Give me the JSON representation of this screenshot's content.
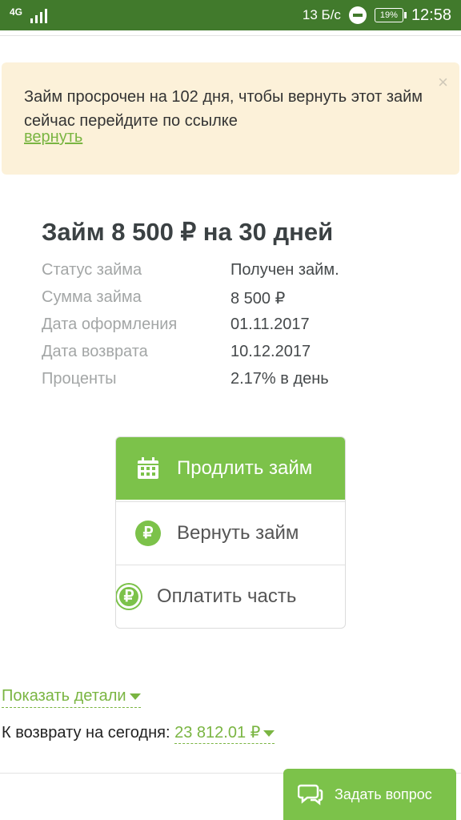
{
  "status_bar": {
    "network": "4G",
    "speed": "13 Б/с",
    "battery": "19%",
    "time": "12:58",
    "icons": [
      "signal-icon",
      "do-not-disturb-icon",
      "battery-icon"
    ]
  },
  "alert": {
    "text": "Займ просрочен на 102 дня, чтобы вернуть этот займ сейчас перейдите по ссылке",
    "link_label": "вернуть",
    "close_label": "×"
  },
  "loan": {
    "title": "Займ 8 500 ₽ на 30 дней",
    "details": [
      {
        "label": "Статус займа",
        "value": "Получен займ."
      },
      {
        "label": "Сумма займа",
        "value": "8 500 ₽"
      },
      {
        "label": "Дата оформления",
        "value": "01.11.2017"
      },
      {
        "label": "Дата возврата",
        "value": "10.12.2017"
      },
      {
        "label": "Проценты",
        "value": "2.17% в день"
      }
    ]
  },
  "actions": {
    "extend": {
      "label": "Продлить займ",
      "icon": "calendar-icon"
    },
    "repay": {
      "label": "Вернуть займ",
      "icon": "ruble-icon",
      "icon_glyph": "₽"
    },
    "pay_part": {
      "label": "Оплатить часть",
      "icon": "ruble-part-icon",
      "icon_glyph": "₽"
    }
  },
  "show_details_label": "Показать детали",
  "repay_today": {
    "label": "К возврату на сегодня:",
    "amount": "23 812.01 ₽"
  },
  "ask_question": {
    "label": "Задать вопрос",
    "icon": "chat-icon"
  },
  "colors": {
    "status_bar": "#417a2c",
    "accent": "#7cc24a",
    "link": "#7ab542",
    "alert_bg": "#fcf1d9"
  }
}
